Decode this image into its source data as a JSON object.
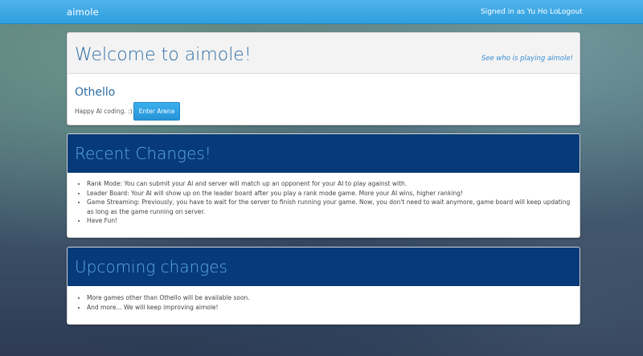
{
  "navbar": {
    "brand": "aimole",
    "signed_in": "Signed in as Yu Ho Lo",
    "logout": "Logout"
  },
  "welcome": {
    "title": "Welcome to aimole!",
    "see_link": "See who is playing aimole!",
    "game_name": "Othello",
    "tagline": "Happy AI coding. :)",
    "enter_button": "Enter Arena"
  },
  "recent": {
    "heading": "Recent Changes!",
    "items": [
      "Rank Mode: You can submit your AI and server will match up an opponent for your AI to play against with.",
      "Leader Board: Your AI will show up on the leader board after you play a rank mode game. More your AI wins, higher ranking!",
      "Game Streaming: Previously, you have to wait for the server to finish running your game. Now, you don't need to wait anymore, game board will keep updating as long as the game running on server.",
      "Have Fun!"
    ]
  },
  "upcoming": {
    "heading": "Upcoming changes",
    "items": [
      "More games other than Othello will be available soon.",
      "And more... We will keep improving aimole!"
    ]
  }
}
